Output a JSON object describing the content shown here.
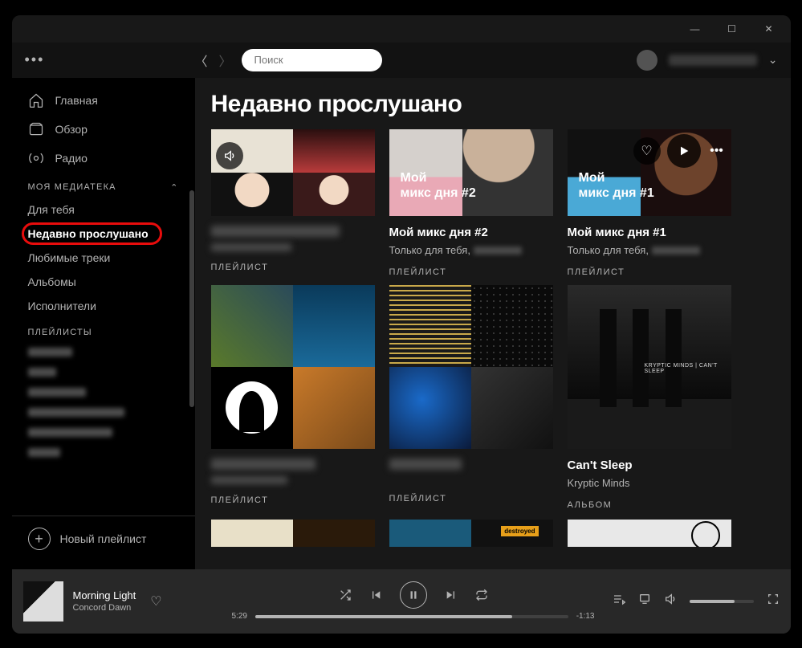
{
  "window": {
    "minimize": "—",
    "maximize": "☐",
    "close": "✕"
  },
  "topbar": {
    "search_placeholder": "Поиск"
  },
  "sidebar": {
    "nav": [
      {
        "label": "Главная"
      },
      {
        "label": "Обзор"
      },
      {
        "label": "Радио"
      }
    ],
    "library_header": "МОЯ МЕДИАТЕКА",
    "library": [
      {
        "label": "Для тебя"
      },
      {
        "label": "Недавно прослушано"
      },
      {
        "label": "Любимые треки"
      },
      {
        "label": "Альбомы"
      },
      {
        "label": "Исполнители"
      }
    ],
    "playlists_header": "ПЛЕЙЛИСТЫ",
    "new_playlist": "Новый плейлист"
  },
  "page_title": "Недавно прослушано",
  "row1": [
    {
      "kind": "ПЛЕЙЛИСТ"
    },
    {
      "title": "Мой микс дня #2",
      "sub_prefix": "Только для тебя, ",
      "kind": "ПЛЕЙЛИСТ",
      "cover_text": "Мой\nмикс дня #2"
    },
    {
      "title": "Мой микс дня #1",
      "sub_prefix": "Только для тебя, ",
      "kind": "ПЛЕЙЛИСТ",
      "cover_text": "Мой\nмикс дня #1"
    }
  ],
  "row2": [
    {
      "kind": "ПЛЕЙЛИСТ"
    },
    {
      "kind": "ПЛЕЙЛИСТ"
    },
    {
      "title": "Can't Sleep",
      "sub": "Kryptic Minds",
      "kind": "АЛЬБОМ",
      "cover_text": "KRYPTIC MINDS | CAN'T SLEEP"
    }
  ],
  "player": {
    "title": "Morning Light",
    "artist": "Concord Dawn",
    "elapsed": "5:29",
    "remaining": "-1:13"
  }
}
